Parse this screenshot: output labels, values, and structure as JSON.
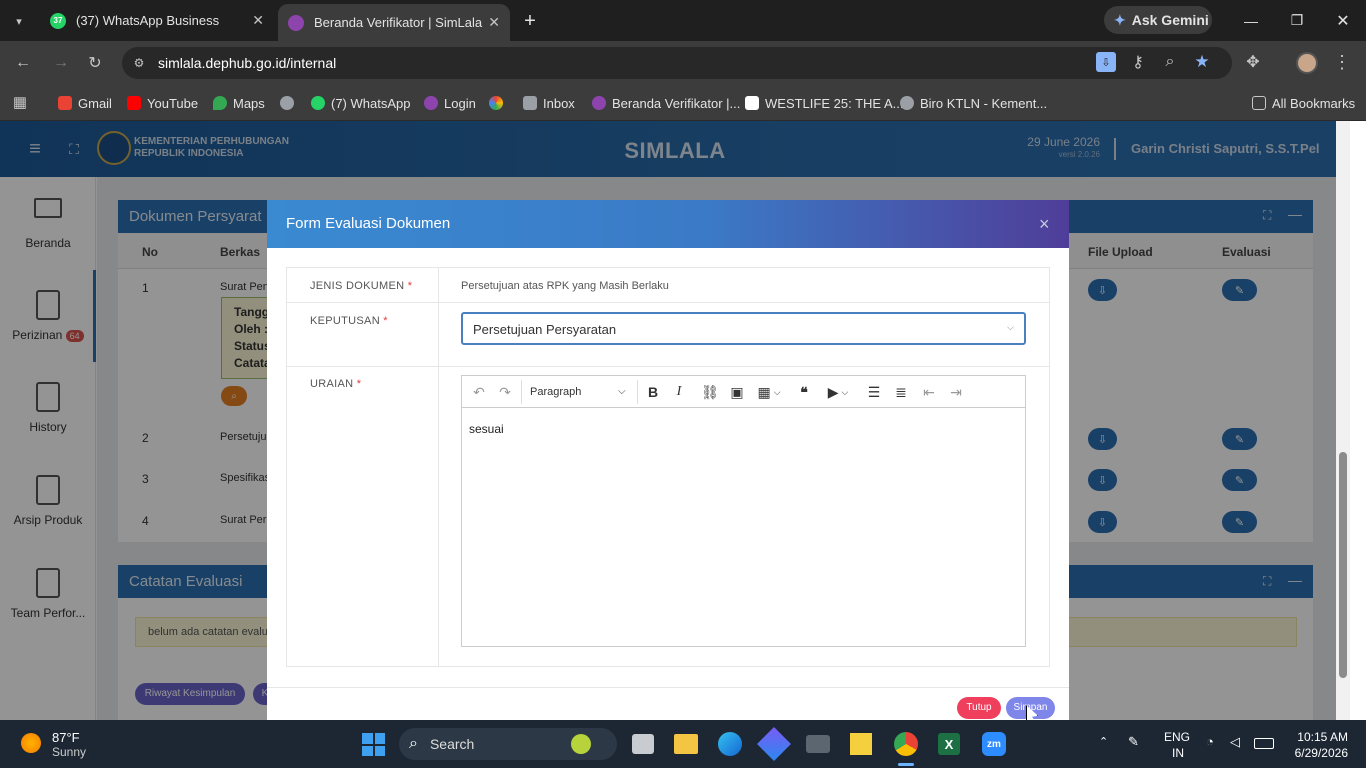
{
  "browser": {
    "tabs": [
      {
        "title": "(37) WhatsApp Business",
        "badge": "37"
      },
      {
        "title": "Beranda Verifikator | SimLala"
      }
    ],
    "new_tab": "+",
    "ask_gemini": "Ask Gemini",
    "url": "simlala.dephub.go.id/internal",
    "bookmarks": [
      {
        "label": "Gmail",
        "color": "#ea4335"
      },
      {
        "label": "YouTube",
        "color": "#ff0000"
      },
      {
        "label": "Maps",
        "color": "#34a853"
      },
      {
        "label": "",
        "color": "#9aa0a6"
      },
      {
        "label": "(7) WhatsApp",
        "color": "#25d366"
      },
      {
        "label": "Login",
        "color": "#8e44ad"
      },
      {
        "label": "",
        "color": "#fbbc04"
      },
      {
        "label": "Inbox",
        "color": "#9aa0a6"
      },
      {
        "label": "Beranda Verifikator |...",
        "color": "#8e44ad"
      },
      {
        "label": "WESTLIFE 25: THE A...",
        "color": "#ffffff"
      },
      {
        "label": "Biro KTLN - Kement...",
        "color": "#9aa0a6"
      }
    ],
    "all_bookmarks": "All Bookmarks"
  },
  "app": {
    "org_line1": "KEMENTERIAN PERHUBUNGAN",
    "org_line2": "REPUBLIK INDONESIA",
    "title": "SIMLALA",
    "date": "29 June 2026",
    "version": "versi 2.0.26",
    "user": "Garin Christi Saputri, S.S.T.Pel"
  },
  "sidebar": {
    "items": [
      {
        "label": "Beranda"
      },
      {
        "label": "Perizinan",
        "badge": "64"
      },
      {
        "label": "History"
      },
      {
        "label": "Arsip Produk"
      },
      {
        "label": "Team Perfor..."
      }
    ]
  },
  "background": {
    "card1_title": "Dokumen Persyarat",
    "col_no": "No",
    "col_berkas": "Berkas",
    "col_file_upload": "File Upload",
    "col_evaluasi": "Evaluasi",
    "rows": [
      {
        "no": "1",
        "berkas": "Surat Pen"
      },
      {
        "no": "2",
        "berkas": "Persetuju"
      },
      {
        "no": "3",
        "berkas": "Spesifikas"
      },
      {
        "no": "4",
        "berkas": "Surat Perr"
      }
    ],
    "note_lines": [
      "Tangg",
      "Oleh :",
      "Status",
      "Catata"
    ],
    "card2_title": "Catatan Evaluasi",
    "card2_note": "belum ada catatan evalu",
    "riwayat_button": "Riwayat Kesimpulan",
    "k_button": "K"
  },
  "modal": {
    "title": "Form Evaluasi Dokumen",
    "close": "×",
    "jenis_label": "JENIS DOKUMEN",
    "jenis_value": "Persetujuan atas RPK yang Masih Berlaku",
    "keputusan_label": "KEPUTUSAN",
    "keputusan_value": "Persetujuan Persyaratan",
    "uraian_label": "URAIAN",
    "required_mark": "*",
    "editor_format": "Paragraph",
    "editor_text": "sesuai",
    "tutup_button": "Tutup",
    "simpan_button": "Simpan"
  },
  "taskbar": {
    "temp": "87°F",
    "weather": "Sunny",
    "search": "Search",
    "lang1": "ENG",
    "lang2": "IN",
    "time": "10:15 AM",
    "date": "6/29/2026"
  }
}
